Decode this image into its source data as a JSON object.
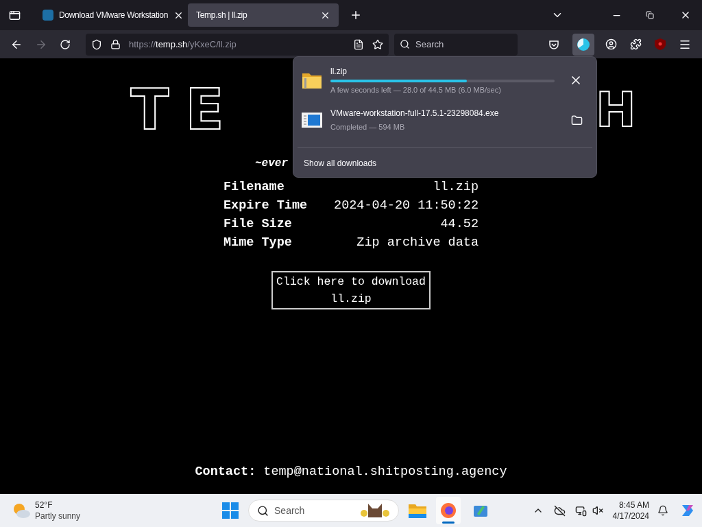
{
  "tabs": [
    {
      "title": "Download VMware Workstation",
      "selected": false
    },
    {
      "title": "Temp.sh | ll.zip",
      "selected": true
    }
  ],
  "address_bar": {
    "scheme": "https://",
    "host": "temp.sh",
    "path": "/yKxeC/ll.zip"
  },
  "search_bar": {
    "placeholder": "Search"
  },
  "downloads_panel": {
    "items": [
      {
        "kind": "in_progress",
        "name": "ll.zip",
        "level": 0.61,
        "status": "A few seconds left — 28.0 of 44.5 MB (6.0 MB/sec)"
      },
      {
        "kind": "completed",
        "name": "VMware-workstation-full-17.5.1-23298084.exe",
        "status": "Completed — 594 MB"
      }
    ],
    "footer_link": "Show all downloads"
  },
  "page": {
    "logo_left": "TE",
    "logo_right": "H",
    "tagline": "~ever",
    "fields": [
      {
        "label": "Filename",
        "value": "ll.zip"
      },
      {
        "label": "Expire Time",
        "value": "2024-04-20 11:50:22"
      },
      {
        "label": "File Size",
        "value": "44.52"
      },
      {
        "label": "Mime Type",
        "value": "Zip archive data"
      }
    ],
    "download_button": "Click here to download ll.zip",
    "contact_label": "Contact:",
    "contact_value": "temp@national.shitposting.agency"
  },
  "taskbar": {
    "weather": {
      "temperature": "52°F",
      "condition": "Partly sunny"
    },
    "search_placeholder": "Search",
    "clock": {
      "time": "8:45 AM",
      "date": "4/17/2024"
    }
  }
}
